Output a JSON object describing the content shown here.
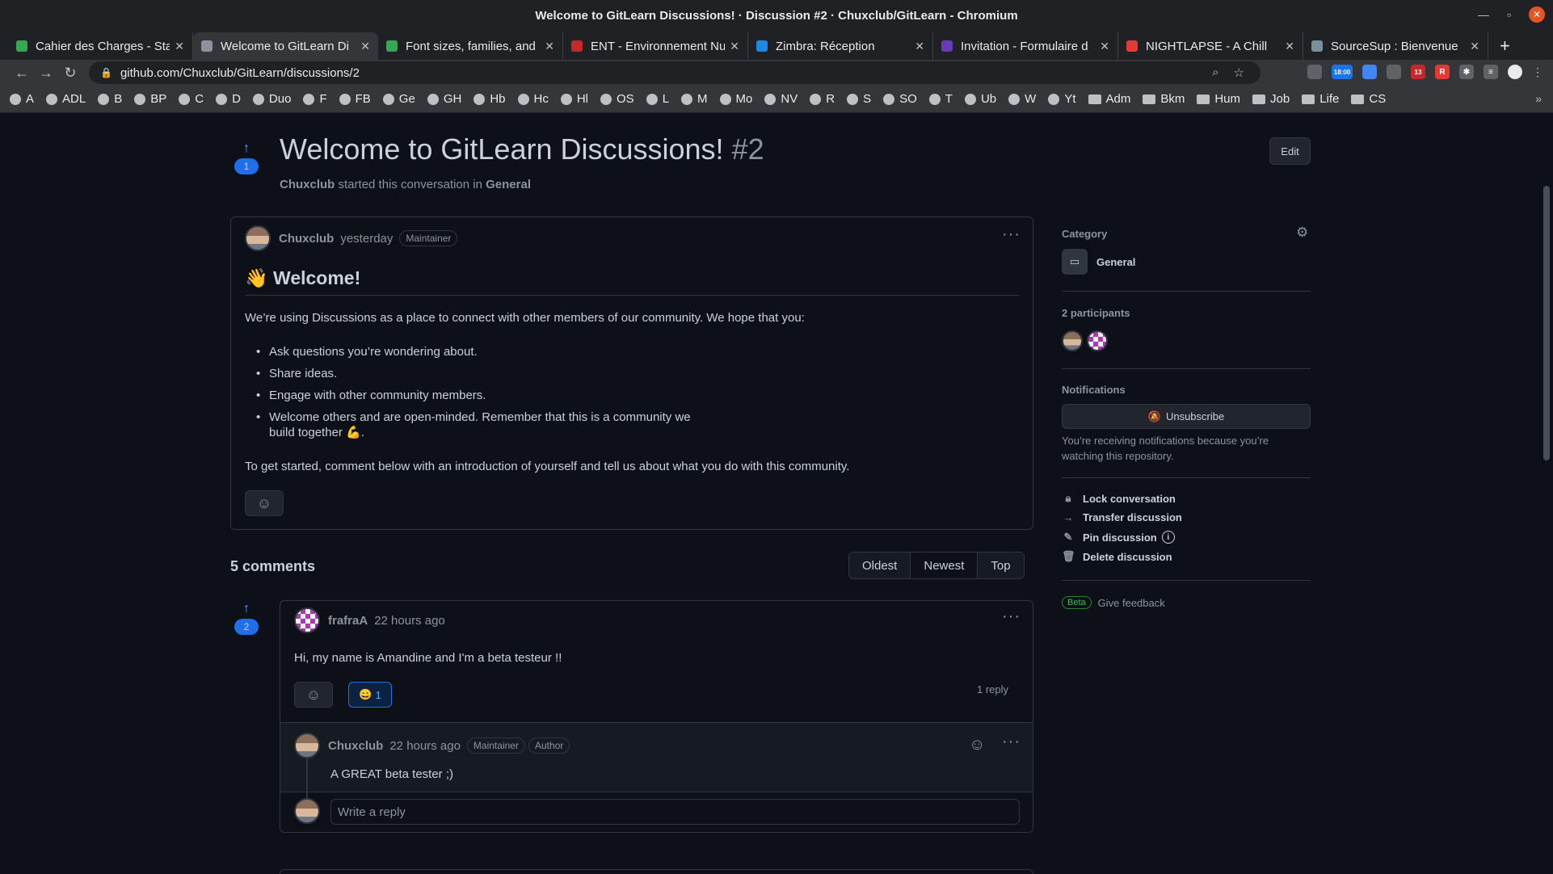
{
  "window": {
    "title": "Welcome to GitLearn Discussions! · Discussion #2 · Chuxclub/GitLearn - Chromium"
  },
  "tabs": [
    {
      "label": "Cahier des Charges - Sta",
      "color": "#34a853"
    },
    {
      "label": "Welcome to GitLearn Di",
      "color": "#8b949e"
    },
    {
      "label": "Font sizes, families, and",
      "color": "#34a853"
    },
    {
      "label": "ENT - Environnement Nu",
      "color": "#c62828"
    },
    {
      "label": "Zimbra: Réception",
      "color": "#1e88e5"
    },
    {
      "label": "Invitation - Formulaire d",
      "color": "#673ab7"
    },
    {
      "label": "NIGHTLAPSE - A Chill",
      "color": "#e53935"
    },
    {
      "label": "SourceSup : Bienvenue",
      "color": "#78909c"
    }
  ],
  "address": {
    "url": "github.com/Chuxclub/GitLearn/discussions/2"
  },
  "extensions": {
    "timer": "18:00",
    "badge": "13"
  },
  "bookmarks": [
    "A",
    "ADL",
    "B",
    "BP",
    "C",
    "D",
    "Duo",
    "F",
    "FB",
    "Ge",
    "GH",
    "Hb",
    "Hc",
    "Hl",
    "OS",
    "L",
    "M",
    "Mo",
    "NV",
    "R",
    "S",
    "SO",
    "T",
    "Ub",
    "W",
    "Yt"
  ],
  "bookmark_folders": [
    "Adm",
    "Bkm",
    "Hum",
    "Job",
    "Life",
    "CS"
  ],
  "discussion": {
    "title": "Welcome to GitLearn Discussions!",
    "number": "#2",
    "author": "Chuxclub",
    "started_text": "started this conversation in",
    "category": "General",
    "votes": "1",
    "edit_label": "Edit"
  },
  "post": {
    "author": "Chuxclub",
    "time": "yesterday",
    "badge": "Maintainer",
    "heading": "👋 Welcome!",
    "intro": "We’re using Discussions as a place to connect with other members of our community. We hope that you:",
    "bullets": [
      "Ask questions you’re wondering about.",
      "Share ideas.",
      "Engage with other community members.",
      "Welcome others and are open-minded. Remember that this is a community we"
    ],
    "bullet_cont": "build together 💪.",
    "outro": "To get started, comment below with an introduction of yourself and tell us about what you do with this community."
  },
  "comments": {
    "count_label": "5 comments",
    "sort": [
      "Oldest",
      "Newest",
      "Top"
    ],
    "first": {
      "votes": "2",
      "author": "frafraA",
      "time": "22 hours ago",
      "text": "Hi, my name is Amandine and I'm a beta testeur !!",
      "reaction_emoji": "😄",
      "reaction_count": "1",
      "reply_count": "1 reply"
    },
    "reply": {
      "author": "Chuxclub",
      "time": "22 hours ago",
      "badge1": "Maintainer",
      "badge2": "Author",
      "text": "A GREAT beta tester ;)",
      "placeholder": "Write a reply"
    }
  },
  "sidebar": {
    "category_label": "Category",
    "category": "General",
    "participants_label": "2 participants",
    "notifications_label": "Notifications",
    "unsubscribe": "Unsubscribe",
    "notif_text1": "You’re receiving notifications because you’re",
    "notif_text2": "watching this repository.",
    "actions": [
      "Lock conversation",
      "Transfer discussion",
      "Pin discussion",
      "Delete discussion"
    ],
    "beta": "Beta",
    "feedback": "Give feedback"
  }
}
